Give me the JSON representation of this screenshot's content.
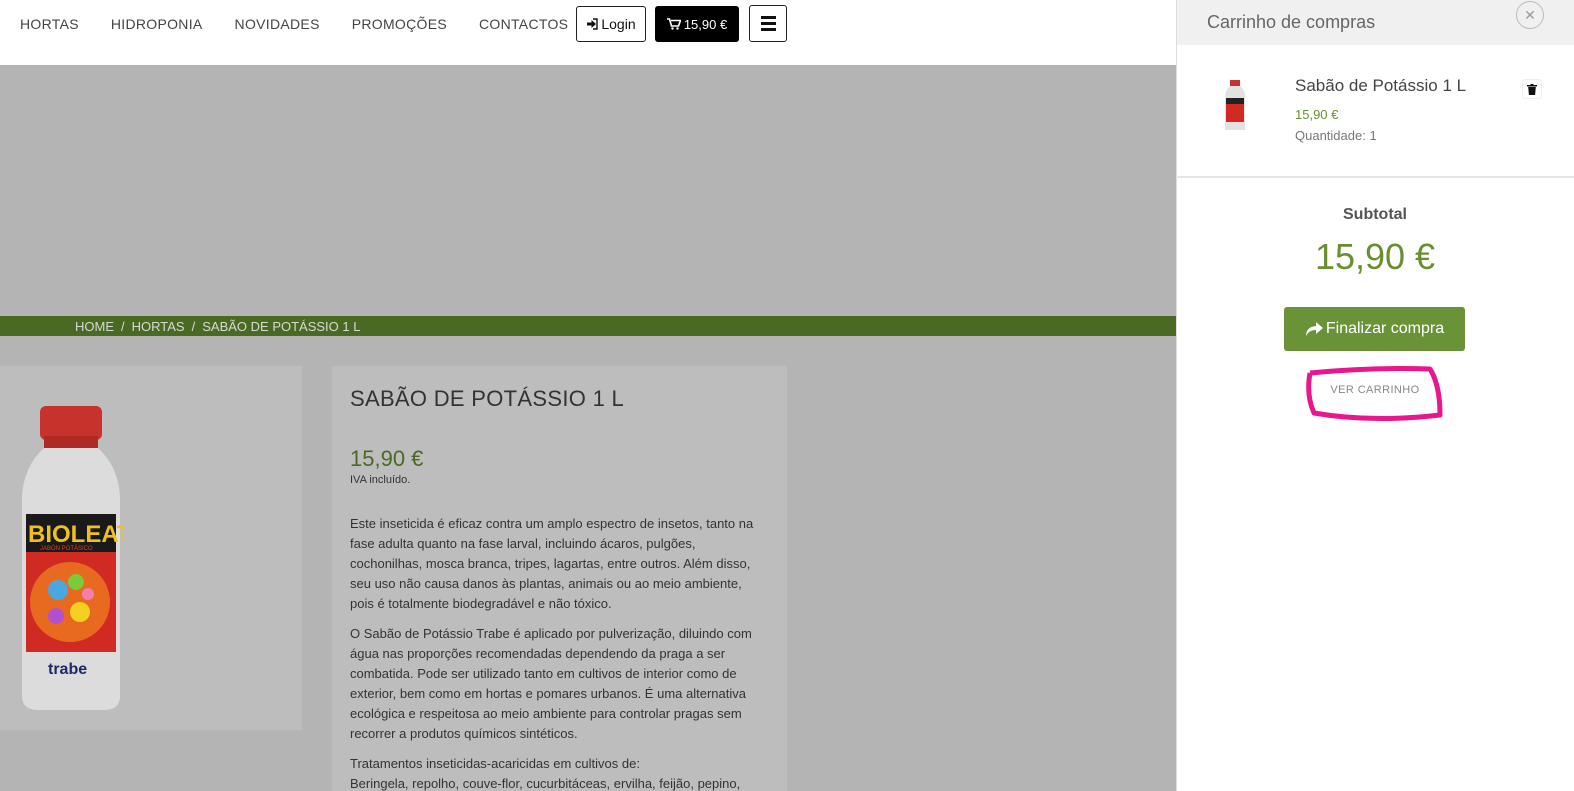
{
  "nav": {
    "items": [
      "HORTAS",
      "HIDROPONIA",
      "NOVIDADES",
      "PROMOÇÕES",
      "CONTACTOS"
    ],
    "login_label": "Login",
    "cart_label": "15,90 €"
  },
  "breadcrumb": {
    "home": "HOME",
    "category": "HORTAS",
    "current": "SABÃO DE POTÁSSIO 1 L",
    "separator": "/"
  },
  "product": {
    "title": "SABÃO DE POTÁSSIO 1 L",
    "price": "15,90 €",
    "tax_note": "IVA incluído.",
    "bottle_brand": "BIOLEAT",
    "bottle_subtitle": "JABÓN POTÁSICO",
    "bottle_maker": "trabe",
    "description": [
      "Este inseticida é eficaz contra um amplo espectro de insetos, tanto na fase adulta quanto na fase larval, incluindo ácaros, pulgões, cochonilhas, mosca branca, tripes, lagartas, entre outros. Além disso, seu uso não causa danos às plantas, animais ou ao meio ambiente, pois é totalmente biodegradável e não tóxico.",
      "O Sabão de Potássio Trabe é aplicado por pulverização, diluindo com água nas proporções recomendadas dependendo da praga a ser combatida. Pode ser utilizado tanto em cultivos de interior como de exterior, bem como em hortas e pomares urbanos. É uma alternativa ecológica e respeitosa ao meio ambiente para controlar pragas sem recorrer a produtos químicos sintéticos.",
      "Tratamentos inseticidas-acaricidas em cultivos de:",
      "Beringela, repolho, couve-flor, cucurbitáceas, ervilha, feijão, pepino,"
    ]
  },
  "cart": {
    "title": "Carrinho de compras",
    "close_icon": "close-icon",
    "item": {
      "name": "Sabão de Potássio 1 L",
      "price": "15,90 €",
      "quantity": "Quantidade: 1"
    },
    "subtotal_label": "Subtotal",
    "subtotal_value": "15,90 €",
    "checkout_label": "Finalizar compra",
    "view_cart_label": "VER CARRINHO"
  },
  "colors": {
    "accent_green": "#6a9237",
    "breadcrumb_green": "#4a6a23",
    "annotation_pink": "#e8168f"
  }
}
